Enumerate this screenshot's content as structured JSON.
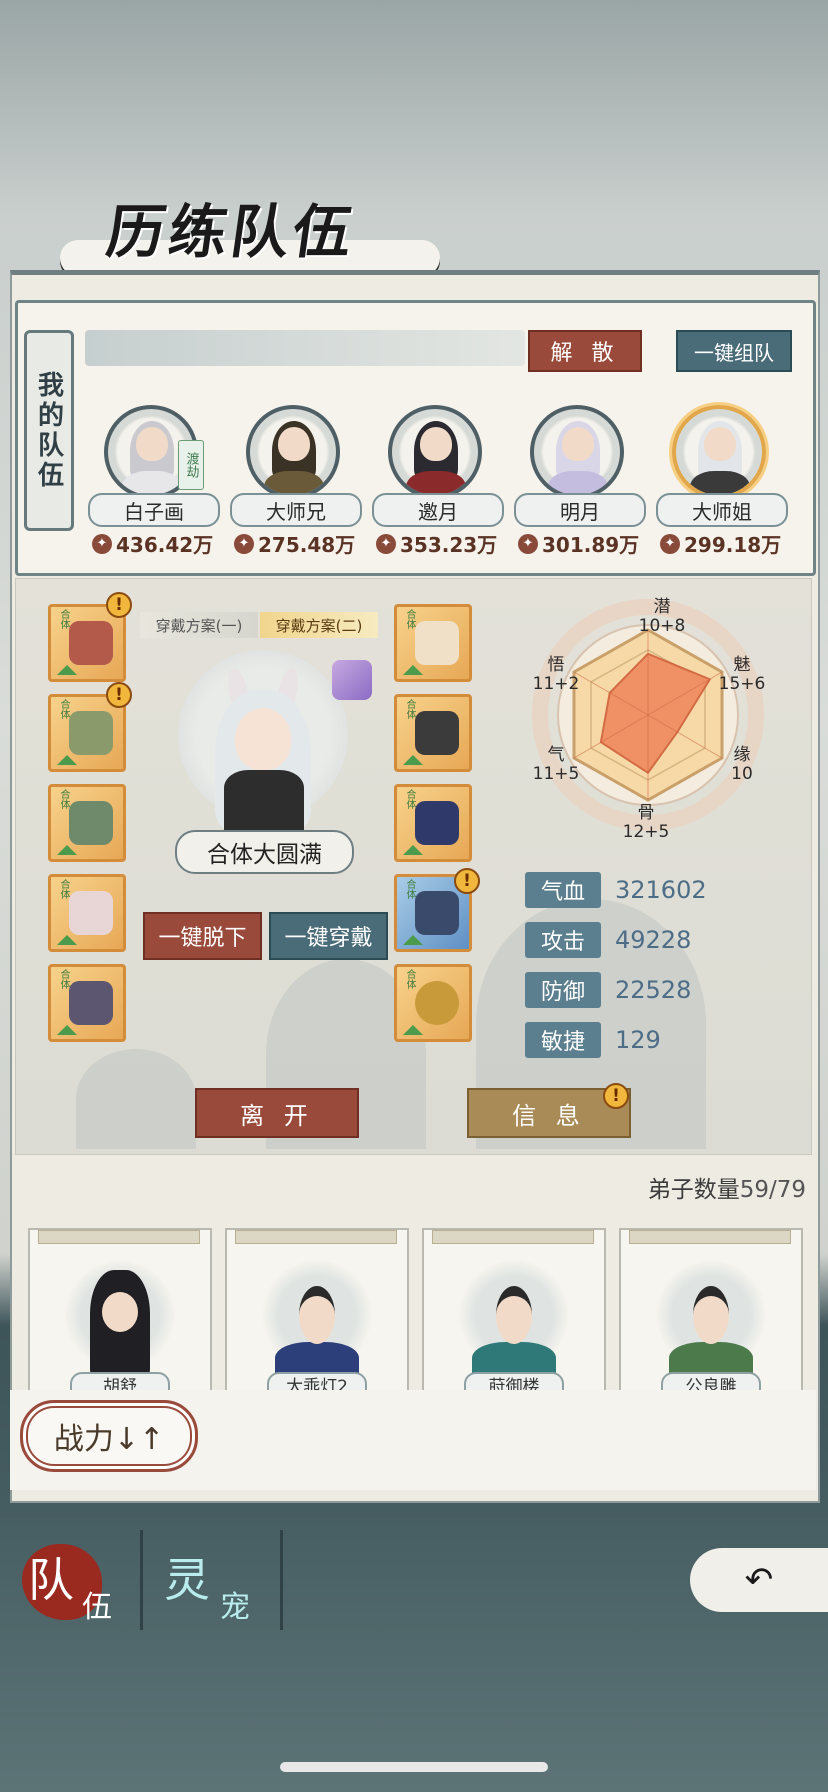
{
  "header": {
    "title": "历练队伍"
  },
  "team": {
    "tag": "我的队伍",
    "disband_label": "解 散",
    "auto_team_label": "一键组队",
    "members": [
      {
        "name": "白子画",
        "power": "436.42万",
        "badge": "渡劫"
      },
      {
        "name": "大师兄",
        "power": "275.48万"
      },
      {
        "name": "邀月",
        "power": "353.23万"
      },
      {
        "name": "明月",
        "power": "301.89万"
      },
      {
        "name": "大师姐",
        "power": "299.18万"
      }
    ]
  },
  "detail": {
    "plan_tabs": [
      "穿戴方案(一)",
      "穿戴方案(二)"
    ],
    "realm": "合体大圆满",
    "take_off_all": "一键脱下",
    "wear_all": "一键穿戴",
    "equip_stage": "合体",
    "attributes": {
      "qian": {
        "name": "潜",
        "value": "10+8"
      },
      "mei": {
        "name": "魅",
        "value": "15+6"
      },
      "yuan": {
        "name": "缘",
        "value": "10"
      },
      "gu": {
        "name": "骨",
        "value": "12+5"
      },
      "qi": {
        "name": "气",
        "value": "11+5"
      },
      "wu": {
        "name": "悟",
        "value": "11+2"
      }
    },
    "stats": [
      {
        "label": "气血",
        "value": "321602"
      },
      {
        "label": "攻击",
        "value": "49228"
      },
      {
        "label": "防御",
        "value": "22528"
      },
      {
        "label": "敏捷",
        "value": "129"
      }
    ],
    "leave_label": "离 开",
    "info_label": "信 息"
  },
  "disciples": {
    "count_label": "弟子数量",
    "count": "59/79",
    "names": [
      "胡舒",
      "大乖灯2",
      "莳御楼",
      "公良雕"
    ]
  },
  "sort": {
    "label": "战力↓↑"
  },
  "nav": {
    "team_main": "队",
    "team_sub": "伍",
    "pet_main": "灵",
    "pet_sub": "宠",
    "back_icon": "↶"
  },
  "colors": {
    "red_button": "#9a4a3b",
    "blue_button": "#4a6c79",
    "stat_label": "#5b7f8e",
    "radar_fill": "#f08a5e"
  }
}
